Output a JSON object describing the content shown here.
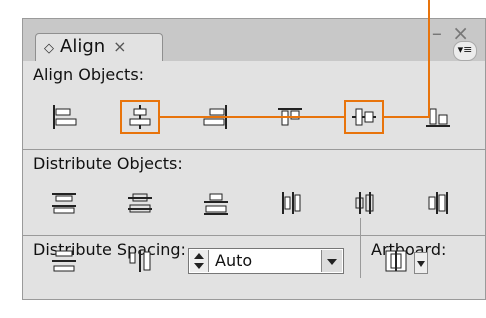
{
  "panel": {
    "tab_label": "Align",
    "tab_close": "×",
    "collapse_glyph": "– ×",
    "menu_glyph": "▾≡"
  },
  "sections": {
    "align_objects": "Align Objects:",
    "distribute_objects": "Distribute Objects:",
    "distribute_spacing": "Distribute Spacing:",
    "artboard": "Artboard:"
  },
  "spacing": {
    "value": "Auto"
  },
  "icons": {
    "align": [
      "horizontal-align-left-icon",
      "horizontal-align-center-icon",
      "horizontal-align-right-icon",
      "vertical-align-top-icon",
      "vertical-align-center-icon",
      "vertical-align-bottom-icon"
    ],
    "distribute": [
      "vertical-distribute-top-icon",
      "vertical-distribute-center-icon",
      "vertical-distribute-bottom-icon",
      "horizontal-distribute-left-icon",
      "horizontal-distribute-center-icon",
      "horizontal-distribute-right-icon"
    ]
  },
  "highlight_color": "#e8740c"
}
